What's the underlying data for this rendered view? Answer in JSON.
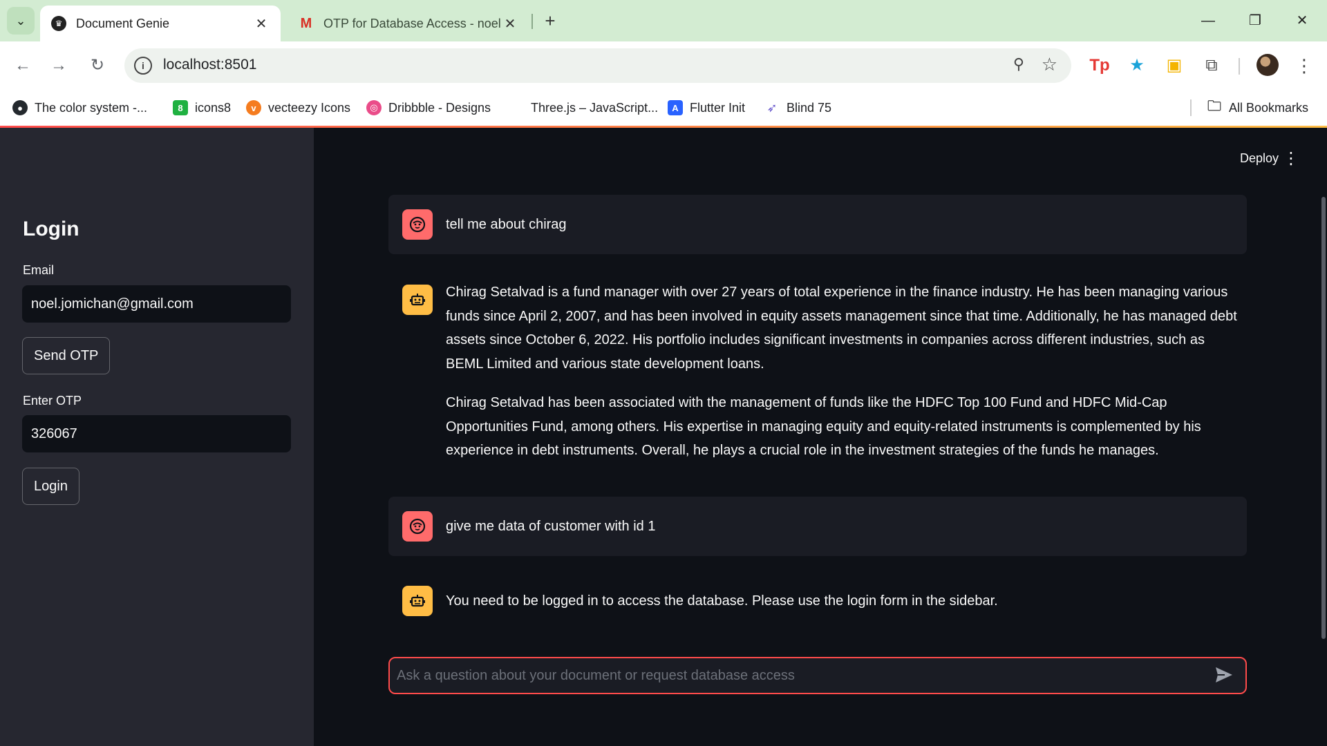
{
  "browser": {
    "tabs": [
      {
        "title": "Document Genie",
        "active": true
      },
      {
        "title": "OTP for Database Access - noel",
        "active": false
      }
    ],
    "new_tab_label": "+",
    "url": "localhost:8501",
    "bookmarks": [
      {
        "label": "The color system -...",
        "icon": "github-icon",
        "color": "#24292e"
      },
      {
        "label": "icons8",
        "icon": "icons8-icon",
        "color": "#1fb141"
      },
      {
        "label": "vecteezy Icons",
        "icon": "vecteezy-icon",
        "color": "#f57c1f"
      },
      {
        "label": "Dribbble - Designs",
        "icon": "dribbble-icon",
        "color": "#ea4c89"
      },
      {
        "label": "Three.js – JavaScript...",
        "icon": "threejs-icon",
        "color": "#ffffff"
      },
      {
        "label": "Flutter Init",
        "icon": "flutter-icon",
        "color": "#2962ff"
      },
      {
        "label": "Blind 75",
        "icon": "rocket-icon",
        "color": "#6a5acd"
      }
    ],
    "all_bookmarks_label": "All Bookmarks"
  },
  "sidebar": {
    "title": "Login",
    "email_label": "Email",
    "email_value": "noel.jomichan@gmail.com",
    "send_otp_label": "Send OTP",
    "otp_label": "Enter OTP",
    "otp_value": "326067",
    "login_label": "Login"
  },
  "header": {
    "deploy_label": "Deploy"
  },
  "chat": {
    "messages": [
      {
        "role": "user",
        "text": "tell me about chirag"
      },
      {
        "role": "assistant",
        "paragraphs": [
          "Chirag Setalvad is a fund manager with over 27 years of total experience in the finance industry. He has been managing various funds since April 2, 2007, and has been involved in equity assets management since that time. Additionally, he has managed debt assets since October 6, 2022. His portfolio includes significant investments in companies across different industries, such as BEML Limited and various state development loans.",
          "Chirag Setalvad has been associated with the management of funds like the HDFC Top 100 Fund and HDFC Mid-Cap Opportunities Fund, among others. His expertise in managing equity and equity-related instruments is complemented by his experience in debt instruments. Overall, he plays a crucial role in the investment strategies of the funds he manages."
        ]
      },
      {
        "role": "user",
        "text": "give me data of customer with id 1"
      },
      {
        "role": "assistant",
        "paragraphs": [
          "You need to be logged in to access the database. Please use the login form in the sidebar."
        ]
      }
    ],
    "input_placeholder": "Ask a question about your document or request database access"
  },
  "colors": {
    "accent": "#ff4b4b",
    "user_avatar": "#ff6b6b",
    "bot_avatar": "#ffbd45",
    "sidebar_bg": "#262730",
    "main_bg": "#0e1117"
  }
}
